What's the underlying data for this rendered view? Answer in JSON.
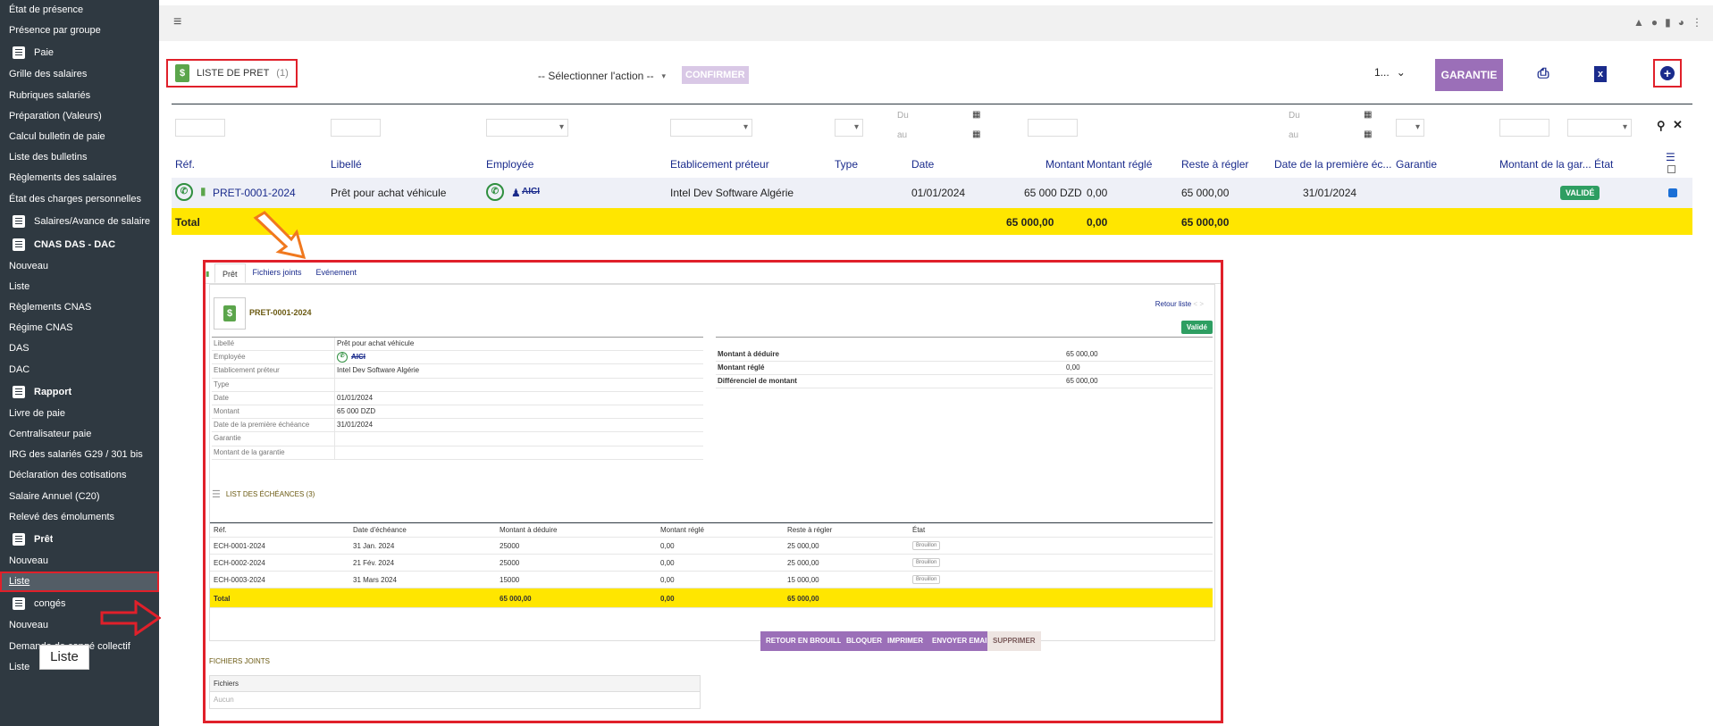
{
  "sidebar": {
    "items": [
      {
        "label": "État de présence",
        "type": "item"
      },
      {
        "label": "Présence par groupe",
        "type": "item"
      },
      {
        "label": "Paie",
        "type": "head-light",
        "icon": "money-icon"
      },
      {
        "label": "Grille des salaires",
        "type": "item"
      },
      {
        "label": "Rubriques salariés",
        "type": "item"
      },
      {
        "label": "Préparation (Valeurs)",
        "type": "item"
      },
      {
        "label": "Calcul bulletin de paie",
        "type": "item"
      },
      {
        "label": "Liste des bulletins",
        "type": "item"
      },
      {
        "label": "Règlements des salaires",
        "type": "item"
      },
      {
        "label": "État des charges personnelles",
        "type": "item"
      },
      {
        "label": "Salaires/Avance de salaire",
        "type": "head-light",
        "icon": "document-icon"
      },
      {
        "label": "CNAS DAS - DAC",
        "type": "head",
        "icon": "document-icon"
      },
      {
        "label": "Nouveau",
        "type": "item"
      },
      {
        "label": "Liste",
        "type": "item"
      },
      {
        "label": "Règlements CNAS",
        "type": "item"
      },
      {
        "label": "Régime CNAS",
        "type": "item"
      },
      {
        "label": "DAS",
        "type": "item"
      },
      {
        "label": "DAC",
        "type": "item"
      },
      {
        "label": "Rapport",
        "type": "head",
        "icon": "document-icon"
      },
      {
        "label": "Livre de paie",
        "type": "item"
      },
      {
        "label": "Centralisateur paie",
        "type": "item"
      },
      {
        "label": "IRG des salariés G29 / 301 bis",
        "type": "item"
      },
      {
        "label": "Déclaration des cotisations",
        "type": "item"
      },
      {
        "label": "Salaire Annuel (C20)",
        "type": "item"
      },
      {
        "label": "Relevé des émoluments",
        "type": "item"
      },
      {
        "label": "Prêt",
        "type": "head",
        "icon": "document-icon"
      },
      {
        "label": "Nouveau",
        "type": "item"
      },
      {
        "label": "Liste",
        "type": "active"
      },
      {
        "label": "congés",
        "type": "head-light",
        "icon": "umbrella-icon"
      },
      {
        "label": "Nouveau",
        "type": "item"
      },
      {
        "label": "Demande de congé collectif",
        "type": "item"
      },
      {
        "label": "Liste",
        "type": "item"
      }
    ],
    "tooltip": "Liste"
  },
  "toolbar": {
    "title": "LISTE DE PRET",
    "count": "(1)",
    "action_select": "-- Sélectionner l'action --",
    "confirm_label": "CONFIRMER",
    "page_size": "1...",
    "garantie_label": "GARANTIE"
  },
  "filters": {
    "du": "Du",
    "au": "au"
  },
  "columns": [
    "Réf.",
    "Libellé",
    "Employée",
    "Etablicement préteur",
    "Type",
    "Date",
    "Montant",
    "Montant réglé",
    "Reste à régler",
    "Date de la première éc...",
    "Garantie",
    "Montant de la gar...",
    "État"
  ],
  "row": {
    "ref": "PRET-0001-2024",
    "libelle": "Prêt pour achat véhicule",
    "employee": "AICI",
    "etablissement": "Intel Dev Software Algérie",
    "date": "01/01/2024",
    "montant": "65 000 DZD",
    "montant_regle": "0,00",
    "reste": "65 000,00",
    "premiere_echeance": "31/01/2024",
    "etat": "VALIDÉ"
  },
  "total_row": {
    "label": "Total",
    "montant": "65 000,00",
    "regle": "0,00",
    "reste": "65 000,00"
  },
  "detail": {
    "tabs": [
      "Prêt",
      "Fichiers joints",
      "Evénement"
    ],
    "ref": "PRET-0001-2024",
    "retour": "Retour liste",
    "status": "Validé",
    "fields": [
      {
        "k": "Libellé",
        "v": "Prêt pour achat véhicule"
      },
      {
        "k": "Employée",
        "v": "AICI"
      },
      {
        "k": "Etablicement préteur",
        "v": "Intel Dev Software Algérie"
      },
      {
        "k": "Type",
        "v": ""
      },
      {
        "k": "Date",
        "v": "01/01/2024"
      },
      {
        "k": "Montant",
        "v": "65 000 DZD"
      },
      {
        "k": "Date de la première échéance",
        "v": "31/01/2024"
      },
      {
        "k": "Garantie",
        "v": ""
      },
      {
        "k": "Montant de la garantie",
        "v": ""
      }
    ],
    "summary": [
      {
        "k": "Montant à déduire",
        "v": "65 000,00"
      },
      {
        "k": "Montant réglé",
        "v": "0,00"
      },
      {
        "k": "Différenciel de montant",
        "v": "65 000,00"
      }
    ],
    "echeances_title": "LIST DES ÉCHÉANCES (3)",
    "ech_columns": [
      "Réf.",
      "Date d'échéance",
      "Montant à déduire",
      "Montant réglé",
      "Reste à régler",
      "État"
    ],
    "echeances": [
      {
        "ref": "ECH-0001-2024",
        "date": "31 Jan. 2024",
        "montant": "25000",
        "regle": "0,00",
        "reste": "25 000,00",
        "etat": "Brouillon"
      },
      {
        "ref": "ECH-0002-2024",
        "date": "21 Fév. 2024",
        "montant": "25000",
        "regle": "0,00",
        "reste": "25 000,00",
        "etat": "Brouillon"
      },
      {
        "ref": "ECH-0003-2024",
        "date": "31 Mars 2024",
        "montant": "15000",
        "regle": "0,00",
        "reste": "15 000,00",
        "etat": "Brouillon"
      }
    ],
    "ech_total": {
      "label": "Total",
      "montant": "65 000,00",
      "regle": "0,00",
      "reste": "65 000,00"
    },
    "buttons": [
      "RETOUR EN BROUILLON",
      "BLOQUER",
      "IMPRIMER",
      "ENVOYER EMAIL",
      "SUPPRIMER"
    ],
    "fichiers_title": "FICHIERS JOINTS",
    "fichiers_head": "Fichiers",
    "fichiers_empty": "Aucun"
  }
}
